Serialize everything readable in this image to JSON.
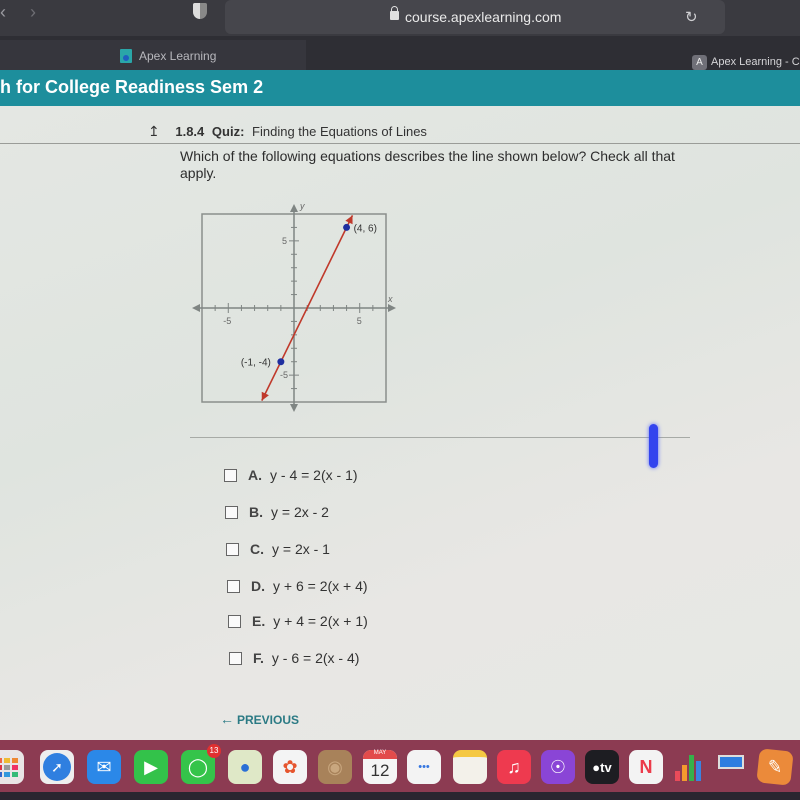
{
  "browser": {
    "url": "course.apexlearning.com",
    "tabs": [
      {
        "title": "Apex Learning",
        "active": true
      },
      {
        "title": "Apex Learning - Co",
        "icon_letter": "A",
        "active": false
      }
    ]
  },
  "course": {
    "title": "h for College Readiness Sem 2"
  },
  "quiz": {
    "number": "1.8.4",
    "kind": "Quiz:",
    "name": "Finding the Equations of Lines",
    "question": "Which of the following equations describes the line shown below? Check all that apply."
  },
  "graph": {
    "x_axis_label": "x",
    "y_axis_label": "y",
    "x_range": [
      -7,
      7
    ],
    "y_range": [
      -7,
      7
    ],
    "tick_labels": {
      "x_neg": "-5",
      "x_pos": "5",
      "y_pos": "5",
      "y_neg": "-5"
    },
    "points": [
      {
        "x": 4,
        "y": 6,
        "label": "(4, 6)"
      },
      {
        "x": -1,
        "y": -4,
        "label": "(-1, -4)"
      }
    ],
    "line": {
      "slope": 2,
      "intercept": -2,
      "color": "#c0392b"
    },
    "point_color": "#1f2fa0"
  },
  "options": [
    {
      "letter": "A.",
      "equation": "y - 4 = 2(x - 1)",
      "checked": false
    },
    {
      "letter": "B.",
      "equation": "y = 2x - 2",
      "checked": false
    },
    {
      "letter": "C.",
      "equation": "y = 2x - 1",
      "checked": false
    },
    {
      "letter": "D.",
      "equation": "y + 6 = 2(x + 4)",
      "checked": false
    },
    {
      "letter": "E.",
      "equation": "y + 4 = 2(x + 1)",
      "checked": false
    },
    {
      "letter": "F.",
      "equation": "y - 6 = 2(x - 4)",
      "checked": false
    }
  ],
  "navigation": {
    "previous_label": "PREVIOUS"
  },
  "dock": {
    "apps": [
      {
        "name": "launchpad"
      },
      {
        "name": "safari"
      },
      {
        "name": "mail"
      },
      {
        "name": "facetime"
      },
      {
        "name": "messages",
        "badge": "13"
      },
      {
        "name": "maps"
      },
      {
        "name": "photos"
      },
      {
        "name": "contacts"
      },
      {
        "name": "calendar",
        "month": "MAY",
        "day": "12"
      },
      {
        "name": "reminders"
      },
      {
        "name": "notes"
      },
      {
        "name": "music"
      },
      {
        "name": "podcasts"
      },
      {
        "name": "apple-tv",
        "label": "tv"
      },
      {
        "name": "news"
      },
      {
        "name": "numbers"
      },
      {
        "name": "keynote"
      },
      {
        "name": "pages"
      }
    ]
  }
}
